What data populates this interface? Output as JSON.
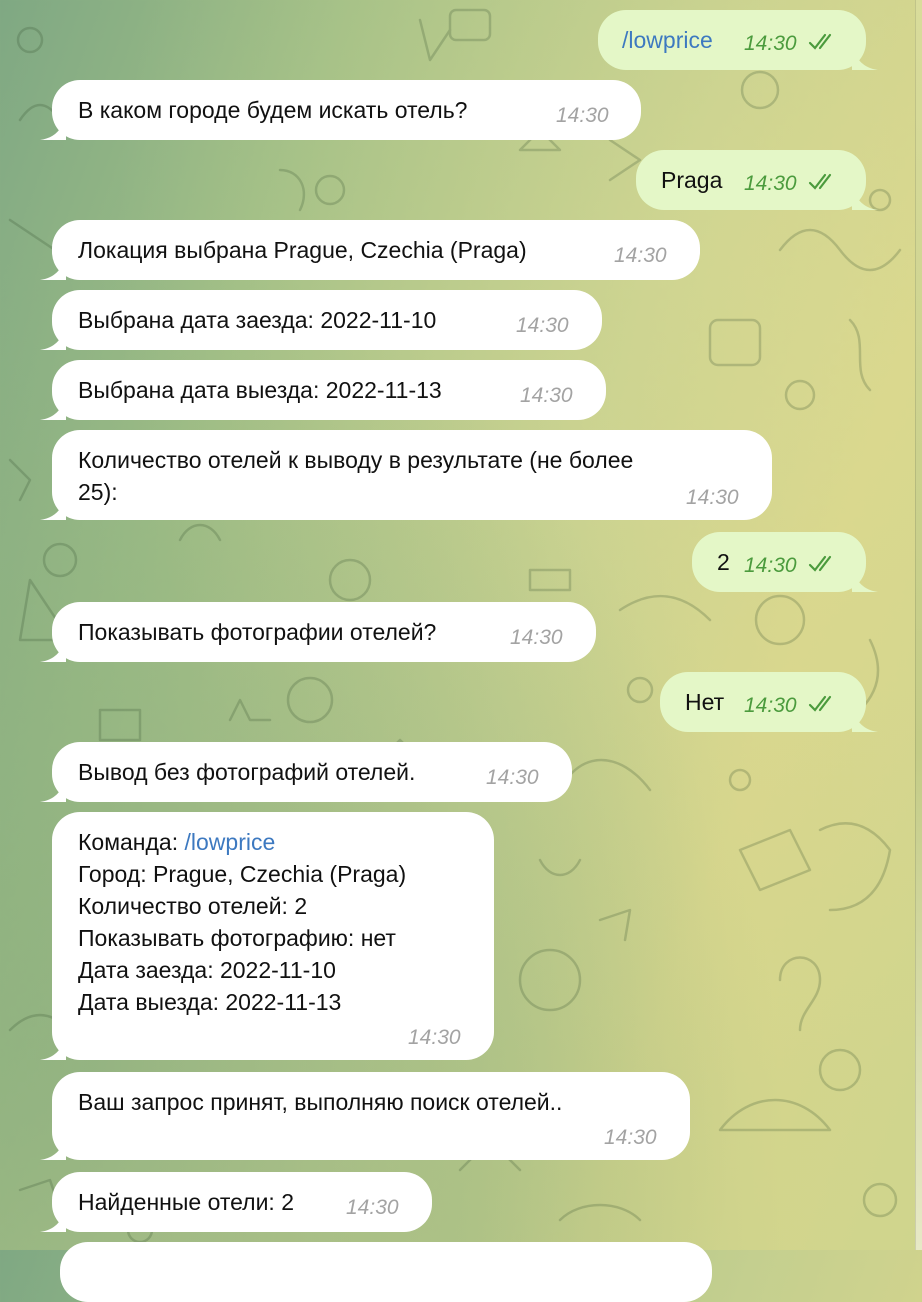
{
  "chat": {
    "messages": [
      {
        "dir": "out",
        "text": "/lowprice",
        "time": "14:30",
        "is_command": true
      },
      {
        "dir": "in",
        "text": "В каком городе будем искать отель?",
        "time": "14:30"
      },
      {
        "dir": "out",
        "text": "Praga",
        "time": "14:30"
      },
      {
        "dir": "in",
        "text": "Локация выбрана Prague, Czechia (Praga)",
        "time": "14:30"
      },
      {
        "dir": "in",
        "text": "Выбрана дата заезда: 2022-11-10",
        "time": "14:30"
      },
      {
        "dir": "in",
        "text": "Выбрана дата выезда: 2022-11-13",
        "time": "14:30"
      },
      {
        "dir": "in",
        "lines": [
          "Количество отелей к выводу в результате (не более",
          "25):"
        ],
        "time": "14:30"
      },
      {
        "dir": "out",
        "text": "2",
        "time": "14:30"
      },
      {
        "dir": "in",
        "text": "Показывать фотографии отелей?",
        "time": "14:30"
      },
      {
        "dir": "out",
        "text": "Нет",
        "time": "14:30"
      },
      {
        "dir": "in",
        "text": "Вывод без фотографий отелей.",
        "time": "14:30"
      },
      {
        "dir": "in",
        "summary": {
          "command_label": "Команда: ",
          "command_link": "/lowprice",
          "lines": [
            "Город: Prague, Czechia (Praga)",
            "Количество отелей: 2",
            "Показывать фотографию: нет",
            "Дата заезда: 2022-11-10",
            "Дата выезда: 2022-11-13"
          ]
        },
        "time": "14:30"
      },
      {
        "dir": "in",
        "text": "Ваш запрос принят, выполняю поиск отелей..",
        "time": "14:30"
      },
      {
        "dir": "in",
        "text": "Найденные отели: 2",
        "time": "14:30"
      }
    ]
  },
  "colors": {
    "incoming_bubble": "#ffffff",
    "outgoing_bubble": "#e4f7c7",
    "outgoing_time": "#4b9b3d",
    "incoming_time": "#a3a3a3",
    "link": "#3d79c0"
  },
  "icons": {
    "read_receipt": "double-check-icon",
    "background": "doodle-pattern"
  }
}
